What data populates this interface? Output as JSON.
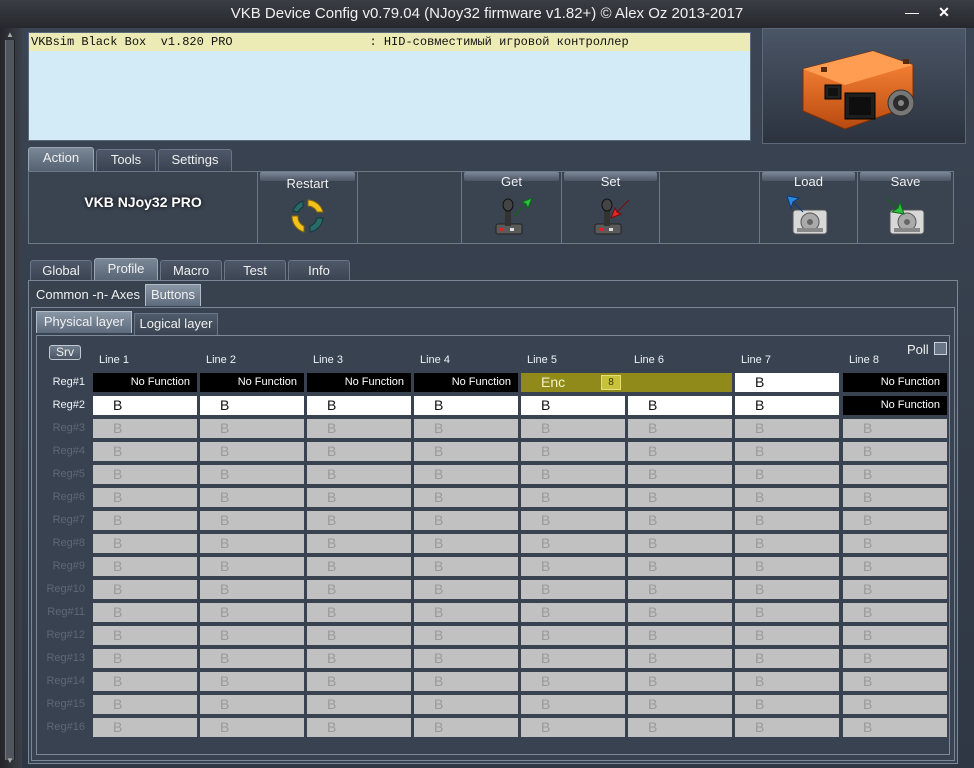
{
  "window": {
    "title": "VKB Device Config v0.79.04 (NJoy32 firmware v1.82+) © Alex Oz 2013-2017",
    "minimize_glyph": "—",
    "close_glyph": "✕"
  },
  "console": {
    "line": "VKBsim Black Box  v1.820 PRO                   : HID-совместимый игровой контроллер"
  },
  "main_tabs": [
    {
      "label": "Action",
      "active": true
    },
    {
      "label": "Tools",
      "active": false
    },
    {
      "label": "Settings",
      "active": false
    }
  ],
  "toolbar": {
    "device_name": "VKB NJoy32 PRO",
    "restart": "Restart",
    "get": "Get",
    "set": "Set",
    "load": "Load",
    "save": "Save"
  },
  "section_tabs": [
    {
      "label": "Global",
      "active": false
    },
    {
      "label": "Profile",
      "active": true
    },
    {
      "label": "Macro",
      "active": false
    },
    {
      "label": "Test",
      "active": false
    },
    {
      "label": "Info",
      "active": false
    }
  ],
  "profile_tabs": [
    {
      "label": "Common -n- Axes",
      "active": false
    },
    {
      "label": "Buttons",
      "active": true
    }
  ],
  "layer_tabs": [
    {
      "label": "Physical layer",
      "active": true
    },
    {
      "label": "Logical layer",
      "active": false
    }
  ],
  "grid": {
    "srv_label": "Srv",
    "poll_label": "Poll",
    "columns": [
      "Line 1",
      "Line 2",
      "Line 3",
      "Line 4",
      "Line 5",
      "Line 6",
      "Line 7",
      "Line 8"
    ],
    "rows": [
      {
        "label": "Reg#1",
        "active": true
      },
      {
        "label": "Reg#2",
        "active": true
      },
      {
        "label": "Reg#3",
        "active": false
      },
      {
        "label": "Reg#4",
        "active": false
      },
      {
        "label": "Reg#5",
        "active": false
      },
      {
        "label": "Reg#6",
        "active": false
      },
      {
        "label": "Reg#7",
        "active": false
      },
      {
        "label": "Reg#8",
        "active": false
      },
      {
        "label": "Reg#9",
        "active": false
      },
      {
        "label": "Reg#10",
        "active": false
      },
      {
        "label": "Reg#11",
        "active": false
      },
      {
        "label": "Reg#12",
        "active": false
      },
      {
        "label": "Reg#13",
        "active": false
      },
      {
        "label": "Reg#14",
        "active": false
      },
      {
        "label": "Reg#15",
        "active": false
      },
      {
        "label": "Reg#16",
        "active": false
      }
    ],
    "no_function_text": "No Function",
    "button_text": "B",
    "enc_text": "Enc",
    "enc_value": "8",
    "row1": [
      "nofunc",
      "nofunc",
      "nofunc",
      "nofunc",
      "enc",
      "enc",
      "white",
      "nofunc"
    ],
    "row2": [
      "white",
      "white",
      "white",
      "white",
      "white",
      "white",
      "white",
      "nofunc"
    ]
  },
  "colors": {
    "no_function_bg": "#000000",
    "enc_bg": "#908a1a",
    "inactive_cell_bg": "#c1c1c1",
    "active_cell_bg": "#ffffff",
    "device_orange": "#e0641c"
  },
  "icons": {
    "restart": "recycle-icon",
    "get": "joystick-download-icon",
    "set": "joystick-upload-icon",
    "load": "disk-load-icon",
    "save": "disk-save-icon"
  }
}
